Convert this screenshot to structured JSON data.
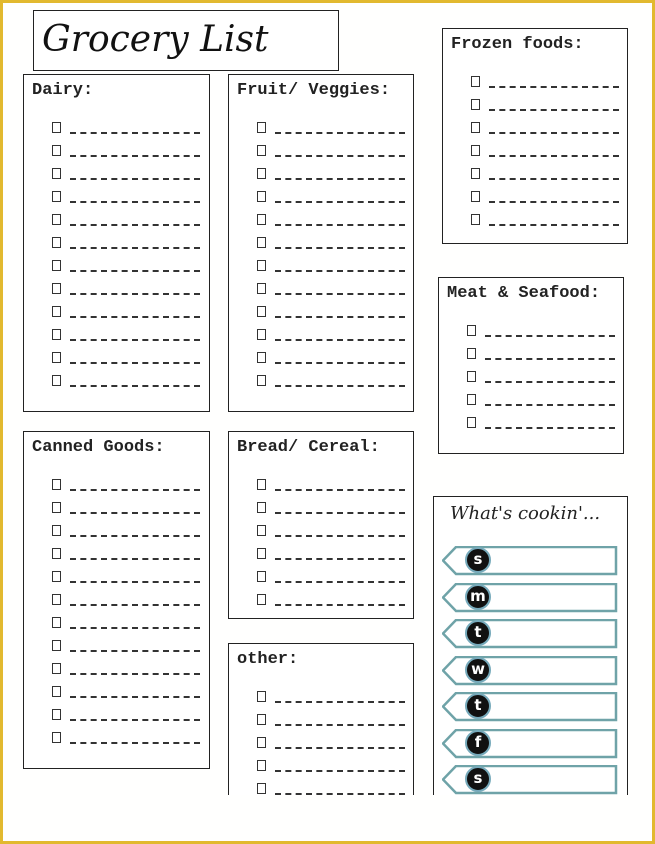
{
  "title": "Grocery List",
  "colors": {
    "border": "#e2b92f",
    "tag_outline": "#6fa3a8",
    "day_circle": "#111111"
  },
  "sections": {
    "dairy": {
      "heading": "Dairy:",
      "items": [
        "",
        "",
        "",
        "",
        "",
        "",
        "",
        "",
        "",
        "",
        "",
        ""
      ]
    },
    "fruit": {
      "heading": "Fruit/ Veggies:",
      "items": [
        "",
        "",
        "",
        "",
        "",
        "",
        "",
        "",
        "",
        "",
        "",
        ""
      ]
    },
    "frozen": {
      "heading": "Frozen foods:",
      "items": [
        "",
        "",
        "",
        "",
        "",
        "",
        ""
      ]
    },
    "meat": {
      "heading": "Meat & Seafood:",
      "items": [
        "",
        "",
        "",
        "",
        ""
      ]
    },
    "canned": {
      "heading": "Canned Goods:",
      "items": [
        "",
        "",
        "",
        "",
        "",
        "",
        "",
        "",
        "",
        "",
        "",
        ""
      ]
    },
    "bread": {
      "heading": "Bread/ Cereal:",
      "items": [
        "",
        "",
        "",
        "",
        "",
        ""
      ]
    },
    "other": {
      "heading": "other:",
      "items": [
        "",
        "",
        "",
        "",
        ""
      ]
    }
  },
  "cookin": {
    "heading": "What's cookin'...",
    "days": [
      "s",
      "m",
      "t",
      "w",
      "t",
      "f",
      "s"
    ]
  }
}
